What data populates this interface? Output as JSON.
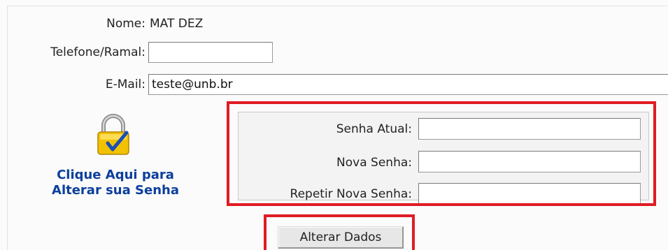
{
  "profile": {
    "name_label": "Nome:",
    "name_value": "MAT DEZ",
    "phone_label": "Telefone/Ramal:",
    "phone_value": "",
    "email_label": "E-Mail:",
    "email_value": "teste@unb.br"
  },
  "password": {
    "link_line1": "Clique Aqui para",
    "link_line2": "Alterar sua Senha",
    "current_label": "Senha Atual:",
    "current_value": "",
    "new_label": "Nova Senha:",
    "new_value": "",
    "repeat_label": "Repetir Nova Senha:",
    "repeat_value": ""
  },
  "actions": {
    "submit_label": "Alterar Dados"
  },
  "colors": {
    "highlight": "#e01b23",
    "link": "#0b3f9c",
    "lock_body": "#f2c200",
    "check": "#1a4fb8"
  },
  "icons": {
    "password_icon": "padlock-check-icon"
  }
}
